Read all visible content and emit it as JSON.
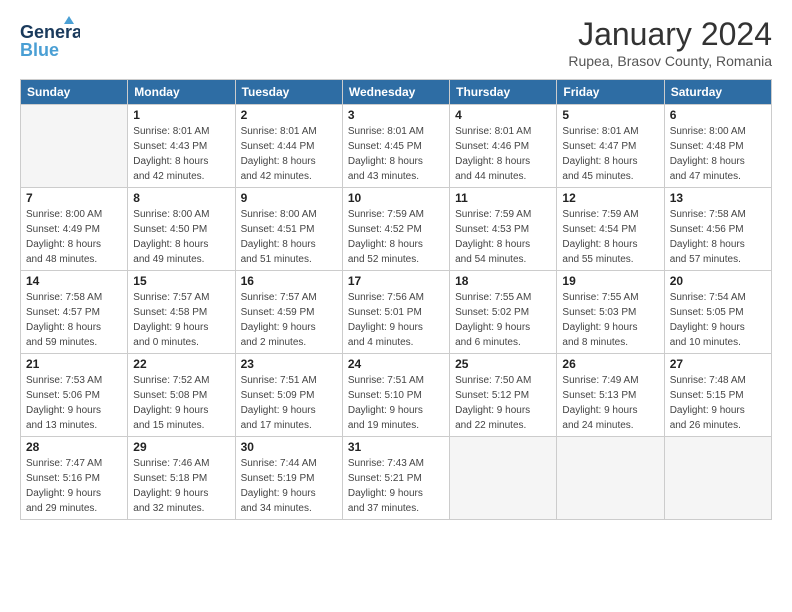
{
  "header": {
    "logo_line1": "General",
    "logo_line2": "Blue",
    "title": "January 2024",
    "subtitle": "Rupea, Brasov County, Romania"
  },
  "weekdays": [
    "Sunday",
    "Monday",
    "Tuesday",
    "Wednesday",
    "Thursday",
    "Friday",
    "Saturday"
  ],
  "weeks": [
    [
      {
        "day": "",
        "info": ""
      },
      {
        "day": "1",
        "info": "Sunrise: 8:01 AM\nSunset: 4:43 PM\nDaylight: 8 hours\nand 42 minutes."
      },
      {
        "day": "2",
        "info": "Sunrise: 8:01 AM\nSunset: 4:44 PM\nDaylight: 8 hours\nand 42 minutes."
      },
      {
        "day": "3",
        "info": "Sunrise: 8:01 AM\nSunset: 4:45 PM\nDaylight: 8 hours\nand 43 minutes."
      },
      {
        "day": "4",
        "info": "Sunrise: 8:01 AM\nSunset: 4:46 PM\nDaylight: 8 hours\nand 44 minutes."
      },
      {
        "day": "5",
        "info": "Sunrise: 8:01 AM\nSunset: 4:47 PM\nDaylight: 8 hours\nand 45 minutes."
      },
      {
        "day": "6",
        "info": "Sunrise: 8:00 AM\nSunset: 4:48 PM\nDaylight: 8 hours\nand 47 minutes."
      }
    ],
    [
      {
        "day": "7",
        "info": "Sunrise: 8:00 AM\nSunset: 4:49 PM\nDaylight: 8 hours\nand 48 minutes."
      },
      {
        "day": "8",
        "info": "Sunrise: 8:00 AM\nSunset: 4:50 PM\nDaylight: 8 hours\nand 49 minutes."
      },
      {
        "day": "9",
        "info": "Sunrise: 8:00 AM\nSunset: 4:51 PM\nDaylight: 8 hours\nand 51 minutes."
      },
      {
        "day": "10",
        "info": "Sunrise: 7:59 AM\nSunset: 4:52 PM\nDaylight: 8 hours\nand 52 minutes."
      },
      {
        "day": "11",
        "info": "Sunrise: 7:59 AM\nSunset: 4:53 PM\nDaylight: 8 hours\nand 54 minutes."
      },
      {
        "day": "12",
        "info": "Sunrise: 7:59 AM\nSunset: 4:54 PM\nDaylight: 8 hours\nand 55 minutes."
      },
      {
        "day": "13",
        "info": "Sunrise: 7:58 AM\nSunset: 4:56 PM\nDaylight: 8 hours\nand 57 minutes."
      }
    ],
    [
      {
        "day": "14",
        "info": "Sunrise: 7:58 AM\nSunset: 4:57 PM\nDaylight: 8 hours\nand 59 minutes."
      },
      {
        "day": "15",
        "info": "Sunrise: 7:57 AM\nSunset: 4:58 PM\nDaylight: 9 hours\nand 0 minutes."
      },
      {
        "day": "16",
        "info": "Sunrise: 7:57 AM\nSunset: 4:59 PM\nDaylight: 9 hours\nand 2 minutes."
      },
      {
        "day": "17",
        "info": "Sunrise: 7:56 AM\nSunset: 5:01 PM\nDaylight: 9 hours\nand 4 minutes."
      },
      {
        "day": "18",
        "info": "Sunrise: 7:55 AM\nSunset: 5:02 PM\nDaylight: 9 hours\nand 6 minutes."
      },
      {
        "day": "19",
        "info": "Sunrise: 7:55 AM\nSunset: 5:03 PM\nDaylight: 9 hours\nand 8 minutes."
      },
      {
        "day": "20",
        "info": "Sunrise: 7:54 AM\nSunset: 5:05 PM\nDaylight: 9 hours\nand 10 minutes."
      }
    ],
    [
      {
        "day": "21",
        "info": "Sunrise: 7:53 AM\nSunset: 5:06 PM\nDaylight: 9 hours\nand 13 minutes."
      },
      {
        "day": "22",
        "info": "Sunrise: 7:52 AM\nSunset: 5:08 PM\nDaylight: 9 hours\nand 15 minutes."
      },
      {
        "day": "23",
        "info": "Sunrise: 7:51 AM\nSunset: 5:09 PM\nDaylight: 9 hours\nand 17 minutes."
      },
      {
        "day": "24",
        "info": "Sunrise: 7:51 AM\nSunset: 5:10 PM\nDaylight: 9 hours\nand 19 minutes."
      },
      {
        "day": "25",
        "info": "Sunrise: 7:50 AM\nSunset: 5:12 PM\nDaylight: 9 hours\nand 22 minutes."
      },
      {
        "day": "26",
        "info": "Sunrise: 7:49 AM\nSunset: 5:13 PM\nDaylight: 9 hours\nand 24 minutes."
      },
      {
        "day": "27",
        "info": "Sunrise: 7:48 AM\nSunset: 5:15 PM\nDaylight: 9 hours\nand 26 minutes."
      }
    ],
    [
      {
        "day": "28",
        "info": "Sunrise: 7:47 AM\nSunset: 5:16 PM\nDaylight: 9 hours\nand 29 minutes."
      },
      {
        "day": "29",
        "info": "Sunrise: 7:46 AM\nSunset: 5:18 PM\nDaylight: 9 hours\nand 32 minutes."
      },
      {
        "day": "30",
        "info": "Sunrise: 7:44 AM\nSunset: 5:19 PM\nDaylight: 9 hours\nand 34 minutes."
      },
      {
        "day": "31",
        "info": "Sunrise: 7:43 AM\nSunset: 5:21 PM\nDaylight: 9 hours\nand 37 minutes."
      },
      {
        "day": "",
        "info": ""
      },
      {
        "day": "",
        "info": ""
      },
      {
        "day": "",
        "info": ""
      }
    ]
  ]
}
